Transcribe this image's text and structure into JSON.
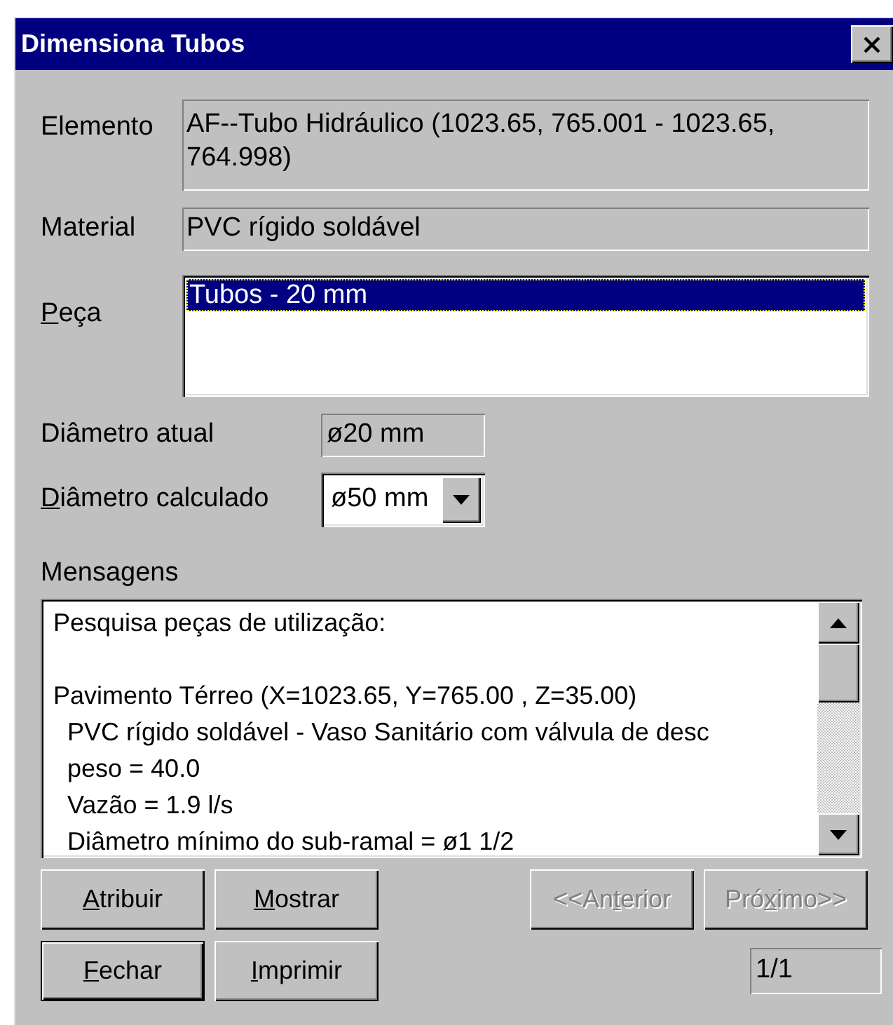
{
  "window": {
    "title": "Dimensiona Tubos"
  },
  "elemento": {
    "label": "Elemento",
    "value": "AF--Tubo Hidráulico (1023.65, 765.001 - 1023.65, 764.998)"
  },
  "material": {
    "label": "Material",
    "value": "PVC rígido soldável"
  },
  "peca": {
    "label": [
      {
        "text": "P",
        "underline": true
      },
      {
        "text": "eça",
        "underline": false
      }
    ],
    "items": [
      {
        "text": "Tubos - 20 mm",
        "selected": true
      }
    ]
  },
  "diametro_atual": {
    "label": "Diâmetro atual",
    "value": "ø20 mm"
  },
  "diametro_calculado": {
    "label": [
      {
        "text": "D",
        "underline": true
      },
      {
        "text": "iâmetro calculado",
        "underline": false
      }
    ],
    "value": "ø50 mm"
  },
  "mensagens": {
    "label": "Mensagens",
    "blocks": [
      [
        "Pesquisa peças de utilização:"
      ],
      [
        "Pavimento Térreo (X=1023.65, Y=765.00 , Z=35.00)",
        "  PVC rígido soldável - Vaso Sanitário com válvula de desc",
        "  peso = 40.0",
        "  Vazão = 1.9 l/s",
        "  Diâmetro mínimo do sub-ramal = ø1 1/2"
      ]
    ]
  },
  "buttons_row1": [
    {
      "label": [
        {
          "text": "A",
          "underline": true
        },
        {
          "text": "tribuir",
          "underline": false
        }
      ],
      "disabled": false,
      "default": false
    },
    {
      "label": [
        {
          "text": "M",
          "underline": true
        },
        {
          "text": "ostrar",
          "underline": false
        }
      ],
      "disabled": false,
      "default": false
    }
  ],
  "nav_buttons": [
    {
      "label": [
        {
          "text": "<<An",
          "underline": false
        },
        {
          "text": "t",
          "underline": true
        },
        {
          "text": "erior",
          "underline": false
        }
      ],
      "disabled": true,
      "default": false
    },
    {
      "label": [
        {
          "text": "Pró",
          "underline": false
        },
        {
          "text": "x",
          "underline": true
        },
        {
          "text": "imo>>",
          "underline": false
        }
      ],
      "disabled": true,
      "default": false
    }
  ],
  "buttons_row2": [
    {
      "label": [
        {
          "text": "F",
          "underline": true
        },
        {
          "text": "echar",
          "underline": false
        }
      ],
      "disabled": false,
      "default": true
    },
    {
      "label": [
        {
          "text": "I",
          "underline": true
        },
        {
          "text": "mprimir",
          "underline": false
        }
      ],
      "disabled": false,
      "default": false
    }
  ],
  "counter": "1/1"
}
